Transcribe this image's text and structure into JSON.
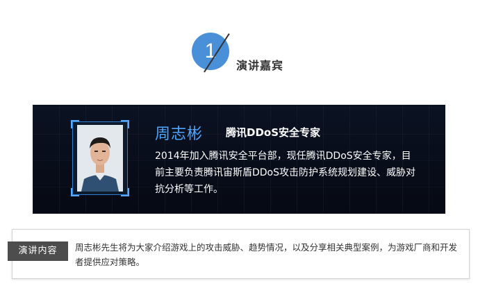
{
  "section": {
    "number": "1",
    "title": "演讲嘉宾"
  },
  "speaker": {
    "name": "周志彬",
    "title": "腾讯DDoS安全专家",
    "bio": "2014年加入腾讯安全平台部，现任腾讯DDoS安全专家，目前主要负责腾讯宙斯盾DDoS攻击防护系统规划建设、威胁对抗分析等工作。"
  },
  "talk": {
    "label": "演讲内容",
    "text": "周志彬先生将为大家介绍游戏上的攻击威胁、趋势情况，以及分享相关典型案例，为游戏厂商和开发者提供应对策略。"
  },
  "colors": {
    "badge": "#4a90d9",
    "name": "#4fa6ff",
    "card_bg": "#070b16",
    "label_bg": "#4d4d4d"
  }
}
